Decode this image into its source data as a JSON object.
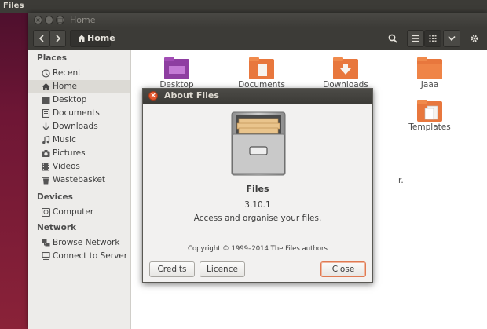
{
  "system_bar": {
    "app_name": "Files"
  },
  "window": {
    "title": "Home",
    "toolbar": {
      "path_button": "Home"
    }
  },
  "sidebar": {
    "places_header": "Places",
    "places": [
      {
        "label": "Recent",
        "icon": "clock-icon"
      },
      {
        "label": "Home",
        "icon": "home-icon",
        "selected": true
      },
      {
        "label": "Desktop",
        "icon": "desktop-folder-icon"
      },
      {
        "label": "Documents",
        "icon": "document-icon"
      },
      {
        "label": "Downloads",
        "icon": "download-arrow-icon"
      },
      {
        "label": "Music",
        "icon": "music-icon"
      },
      {
        "label": "Pictures",
        "icon": "camera-icon"
      },
      {
        "label": "Videos",
        "icon": "film-icon"
      },
      {
        "label": "Wastebasket",
        "icon": "trash-icon"
      }
    ],
    "devices_header": "Devices",
    "devices": [
      {
        "label": "Computer",
        "icon": "drive-icon"
      }
    ],
    "network_header": "Network",
    "network": [
      {
        "label": "Browse Network",
        "icon": "network-icon"
      },
      {
        "label": "Connect to Server",
        "icon": "server-icon"
      }
    ]
  },
  "files": [
    {
      "label": "Desktop",
      "icon": "desktop-folder-icon"
    },
    {
      "label": "Documents",
      "icon": "documents-folder-icon"
    },
    {
      "label": "Downloads",
      "icon": "downloads-folder-icon"
    },
    {
      "label": "Jaaa",
      "icon": "folder-icon"
    },
    {
      "label": "Templates",
      "icon": "templates-folder-icon"
    }
  ],
  "hidden_fragment": "r.",
  "about": {
    "title": "About Files",
    "app_name": "Files",
    "version": "3.10.1",
    "description": "Access and organise your files.",
    "copyright": "Copyright © 1999–2014 The Files authors",
    "credits_button": "Credits",
    "licence_button": "Licence",
    "close_button": "Close"
  },
  "colors": {
    "accent": "#e4572e",
    "folder_orange": "#e8773d",
    "toolbar_dark": "#3c3b37"
  }
}
